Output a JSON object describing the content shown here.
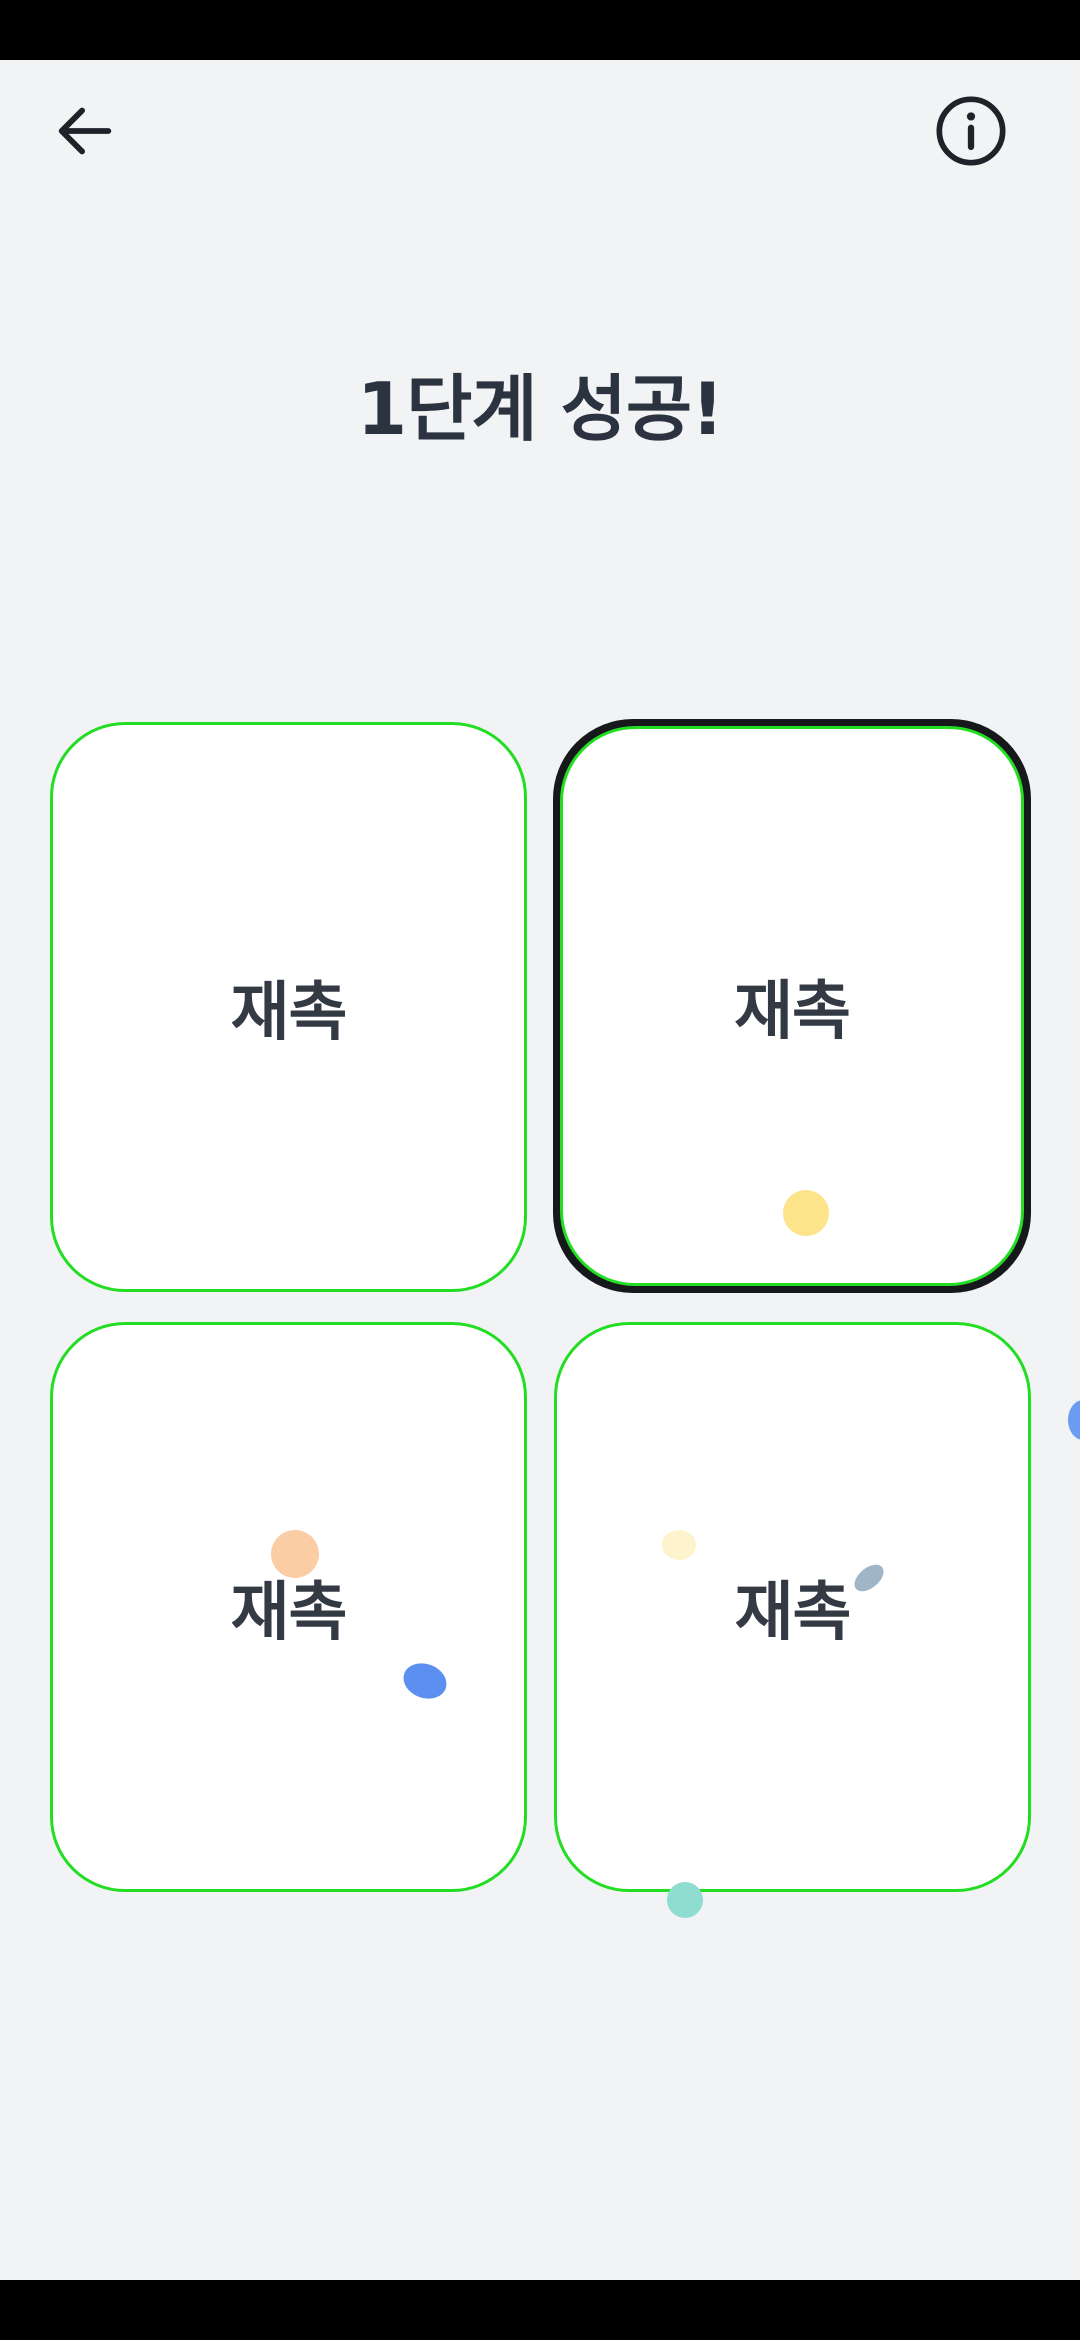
{
  "header": {
    "back_icon": "arrow-left-icon",
    "info_icon": "info-circle-icon"
  },
  "title": "1단계 성공!",
  "cards": [
    {
      "label": "재촉",
      "selected": false
    },
    {
      "label": "재촉",
      "selected": true
    },
    {
      "label": "재촉",
      "selected": false
    },
    {
      "label": "재촉",
      "selected": false
    }
  ],
  "colors": {
    "background": "#f2f3f5",
    "card": "#ffffff",
    "card_border": "#22dd22",
    "selected_border": "#16181c",
    "text": "#2c3340",
    "confetti": [
      "#fde48a",
      "#f9c89a",
      "#5b8ff0",
      "#fdf3cc",
      "#9fb6c9",
      "#8fdcd0",
      "#6c9cf2"
    ]
  }
}
